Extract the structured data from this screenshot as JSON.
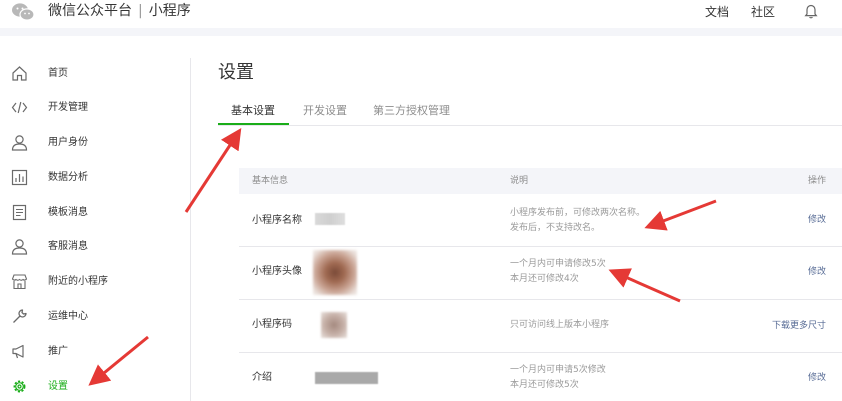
{
  "header": {
    "brand": "微信公众平台",
    "separator": "|",
    "product": "小程序",
    "links": [
      "文档",
      "社区"
    ]
  },
  "sidebar": {
    "items": [
      {
        "label": "首页",
        "icon": "home-icon"
      },
      {
        "label": "开发管理",
        "icon": "code-icon"
      },
      {
        "label": "用户身份",
        "icon": "user-icon"
      },
      {
        "label": "数据分析",
        "icon": "chart-icon"
      },
      {
        "label": "模板消息",
        "icon": "document-icon"
      },
      {
        "label": "客服消息",
        "icon": "support-user-icon"
      },
      {
        "label": "附近的小程序",
        "icon": "store-icon"
      },
      {
        "label": "运维中心",
        "icon": "wrench-icon"
      },
      {
        "label": "推广",
        "icon": "megaphone-icon"
      },
      {
        "label": "设置",
        "icon": "gear-icon"
      }
    ],
    "active_index": 9
  },
  "page": {
    "title": "设置",
    "tabs": [
      "基本设置",
      "开发设置",
      "第三方授权管理"
    ],
    "active_tab": 0
  },
  "table": {
    "headers": {
      "info": "基本信息",
      "desc": "说明",
      "action": "操作"
    },
    "rows": [
      {
        "label": "小程序名称",
        "desc1": "小程序发布前，可修改两次名称。",
        "desc2": "发布后，不支持改名。",
        "action": "修改"
      },
      {
        "label": "小程序头像",
        "desc1": "一个月内可申请修改5次",
        "desc2": "本月还可修改4次",
        "action": "修改"
      },
      {
        "label": "小程序码",
        "desc1": "只可访问线上版本小程序",
        "desc2": "",
        "action": "下载更多尺寸"
      },
      {
        "label": "介绍",
        "desc1": "一个月内可申请5次修改",
        "desc2": "本月还可修改5次",
        "action": "修改"
      }
    ]
  },
  "colors": {
    "accent": "#1aad19",
    "link": "#576b95",
    "annotation": "#e53935",
    "header_bg": "#f4f5f9"
  }
}
